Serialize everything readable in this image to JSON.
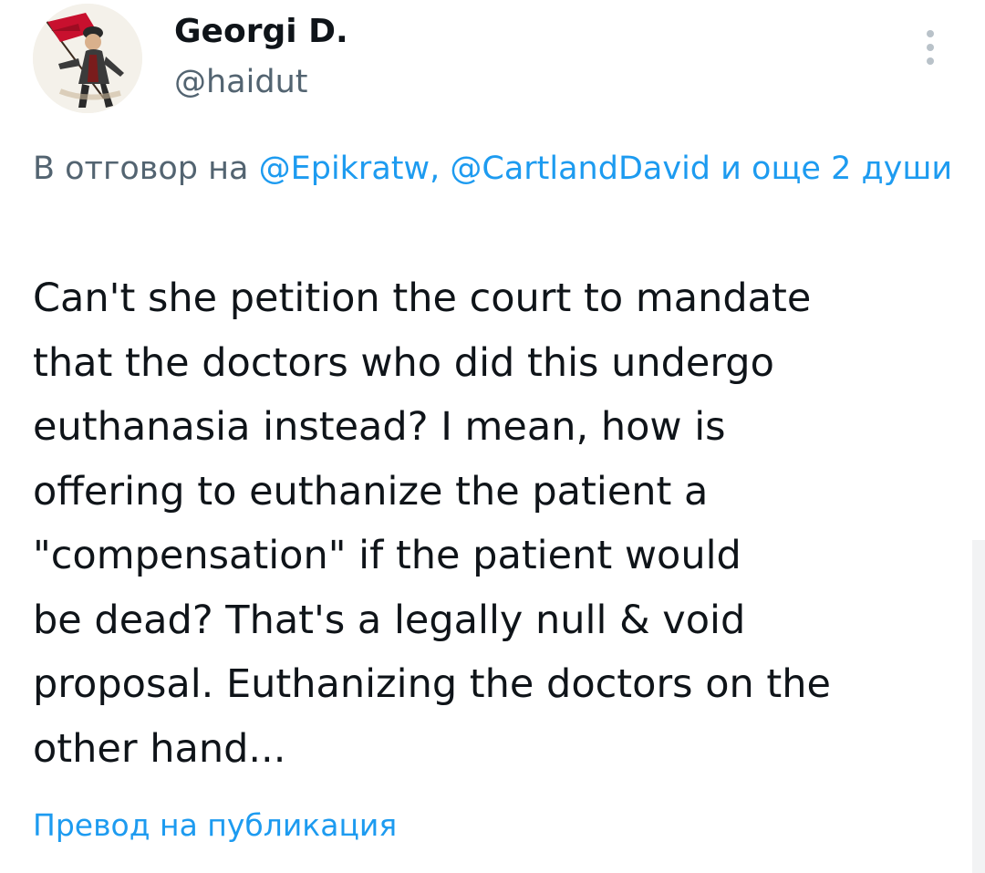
{
  "author": {
    "display_name": "Georgi D.",
    "handle": "@haidut",
    "avatar_icon": "warrior-with-red-flag-avatar"
  },
  "reply_context": {
    "prefix": "В отговор на",
    "mention_1": "@Epikratw,",
    "mention_2": "@CartlandDavid",
    "suffix": "и още 2 души"
  },
  "tweet": {
    "lines": [
      "Can't she petition the court to mandate",
      "that the doctors who did this undergo",
      "euthanasia instead? I mean, how is",
      "offering to euthanize the patient a",
      "\"compensation\" if the patient would",
      "be dead? That's a legally null & void",
      "proposal. Euthanizing the doctors on the",
      "other hand..."
    ]
  },
  "translate_label": "Превод на публикация",
  "colors": {
    "text": "#0f1419",
    "secondary": "#536471",
    "link": "#1d9bf0",
    "more_dots": "#b9c2c9",
    "avatar_flag": "#c8102e"
  }
}
